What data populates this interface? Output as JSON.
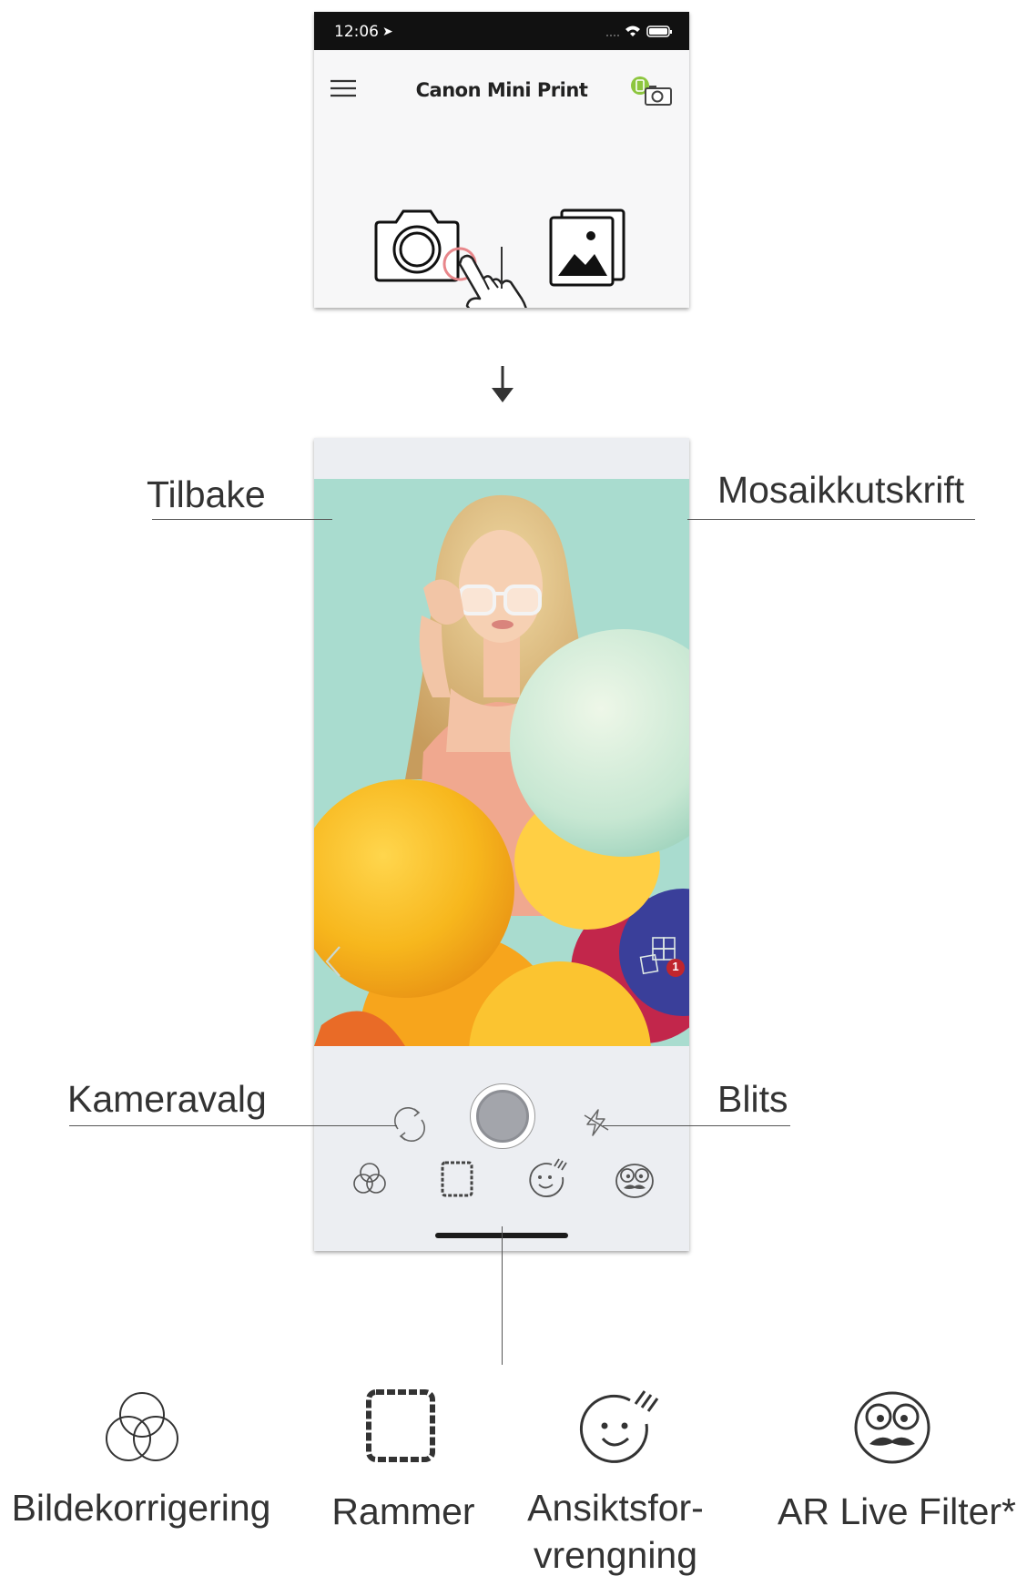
{
  "status_bar": {
    "time": "12:06"
  },
  "app": {
    "title": "Canon Mini Print"
  },
  "icons": {
    "menu": "hamburger-menu-icon",
    "printer": "printer-status-icon",
    "camera": "camera-icon",
    "gallery": "gallery-icon",
    "tap": "tap-hand-icon",
    "arrow": "arrow-down-icon",
    "back": "chevron-left-icon",
    "mosaic": "mosaic-grid-icon",
    "flip": "camera-flip-icon",
    "flash": "flash-off-icon",
    "enhance": "color-circles-icon",
    "frames": "frame-icon",
    "face": "face-distortion-icon",
    "ar": "ar-face-mustache-icon"
  },
  "mosaic_badge": "1",
  "callouts": {
    "back": "Tilbake",
    "mosaic": "Mosaikkutskrift",
    "camera_select": "Kameravalg",
    "flash": "Blits"
  },
  "features": [
    {
      "label": "Bildekorrigering"
    },
    {
      "label": "Rammer"
    },
    {
      "label": "Ansiktsfor-",
      "label2": "vrengning"
    },
    {
      "label": "AR Live Filter*"
    }
  ],
  "colors": {
    "printer_indicator": "#8dc63f",
    "badge": "#c0262d",
    "tap_ring": "#e8868a",
    "viewfinder_bg": "#a9dccf"
  }
}
